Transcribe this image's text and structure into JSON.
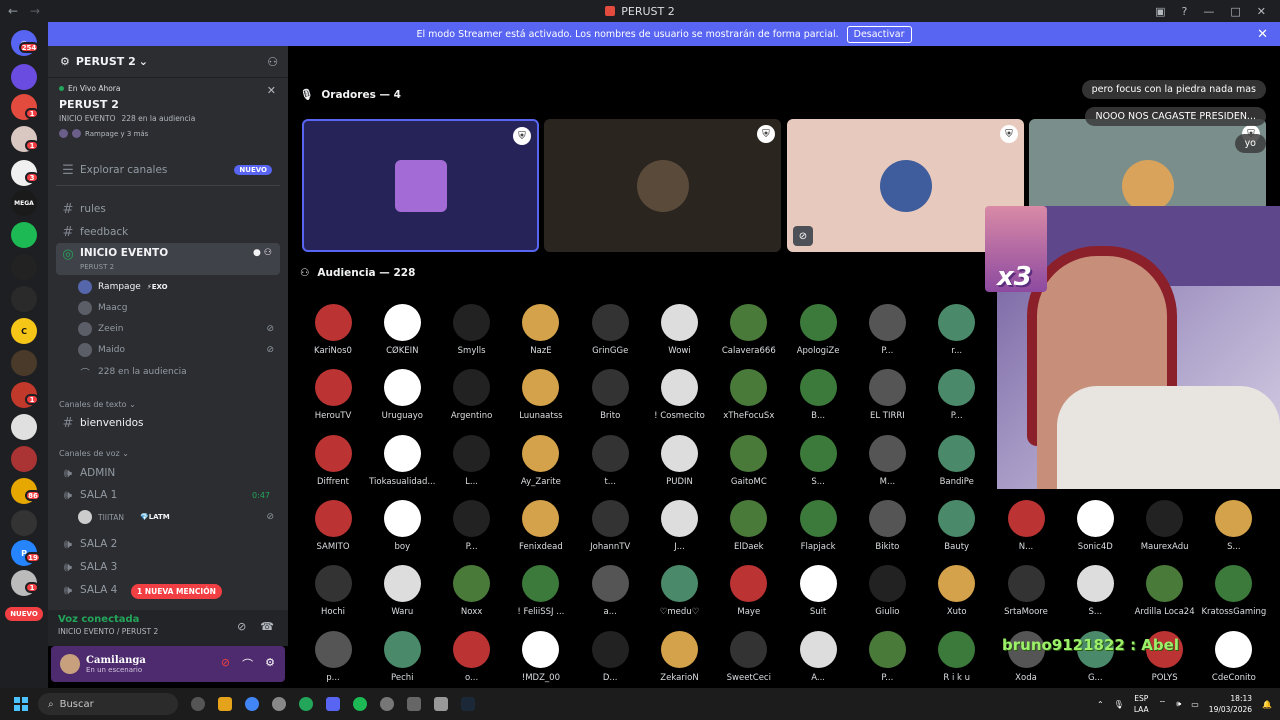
{
  "window": {
    "title": "PERUST 2"
  },
  "banner": {
    "text": "El modo Streamer está activado. Los nombres de usuario se mostrarán de forma parcial.",
    "button": "Desactivar"
  },
  "server_rail": {
    "badges": [
      "254",
      "1",
      "1",
      "1",
      "3",
      "1",
      "1",
      "1",
      "1",
      "1",
      "86",
      "19",
      "1",
      "1"
    ],
    "new_label": "NUEVO"
  },
  "sidebar": {
    "server_name": "PERUST 2",
    "live_label": "En Vivo Ahora",
    "live_title": "PERUST 2",
    "live_event": "INICIO EVENTO",
    "live_audience": "228 en la audiencia",
    "live_members": "Rampage y 3 más",
    "explore": "Explorar canales",
    "explore_badge": "NUEVO",
    "channels": [
      "rules",
      "feedback"
    ],
    "stage_channel": "INICIO EVENTO",
    "stage_sub": "PERUST 2",
    "stage_members": [
      {
        "name": "Rampage",
        "tag": "EXO"
      },
      {
        "name": "Maacg"
      },
      {
        "name": "Zeein"
      },
      {
        "name": "Maido"
      }
    ],
    "stage_audience": "228 en la audiencia",
    "text_category": "Canales de texto",
    "text_channel": "bienvenidos",
    "voice_category": "Canales de voz",
    "voice_channels": [
      "ADMIN",
      "SALA 1",
      "SALA 2",
      "SALA 3",
      "SALA 4"
    ],
    "sala1_time": "0:47",
    "sala1_member": "TIIITAN",
    "sala1_tag": "LATM",
    "mention": "1 NUEVA MENCIÓN"
  },
  "voice": {
    "status": "Voz conectada",
    "location": "INICIO EVENTO / PERUST 2"
  },
  "user": {
    "name": "Camilanga",
    "status": "En un escenario"
  },
  "stage": {
    "speakers_label": "Oradores — 4",
    "audience_label": "Audiencia — 228",
    "audience": [
      "KariÑos0",
      "CØKEIN",
      "Smylls",
      "NazE",
      "GrinGGe",
      "Wowi",
      "Calavera666",
      "ApologiZe",
      "P...",
      "r...",
      "HerouTV",
      "Uruguayo",
      "Argentino",
      "Luunaatss",
      "Brito",
      "! Cosmecito",
      "xTheFocuSx",
      "B...",
      "EL TIRRI",
      "P...",
      "Diffrent",
      "Tiokasualidad...",
      "L...",
      "Ay_Zarite",
      "t...",
      "PUDÍN",
      "GaitoMC",
      "S...",
      "M...",
      "BandiPe",
      "SAMITO",
      "boy",
      "P...",
      "Fenixdead",
      "JohannTV",
      "J...",
      "ElDaek",
      "Flapjack",
      "Bikito",
      "Bauty",
      "N...",
      "Sonic4D",
      "MaurexAdu",
      "S...",
      "Hochi",
      "Waru",
      "Noxx",
      "! FeliiSSJ ...",
      "a...",
      "♡medu♡",
      "Maye",
      "Suit",
      "Giulio",
      "Xuto",
      "SrtaMoore",
      "S...",
      "Ardilla Loca24",
      "KratossGaming",
      "p...",
      "Pechi",
      "o...",
      "!MDZ_00",
      "D...",
      "ZekarioN",
      "SweetCeci",
      "A...",
      "P...",
      "R i k u",
      "Xoda",
      "G...",
      "POLYS",
      "CdeConito"
    ]
  },
  "chat": [
    "pero focus con la piedra nada mas",
    "NOOO NOS CAGASTE PRESIDEN...",
    "yo"
  ],
  "overlay": {
    "sticker": "x3",
    "text": "bruno9121822 : Abel"
  },
  "taskbar": {
    "search": "Buscar",
    "lang1": "ESP",
    "lang2": "LAA",
    "time": "18:13",
    "date": "19/03/2026"
  }
}
